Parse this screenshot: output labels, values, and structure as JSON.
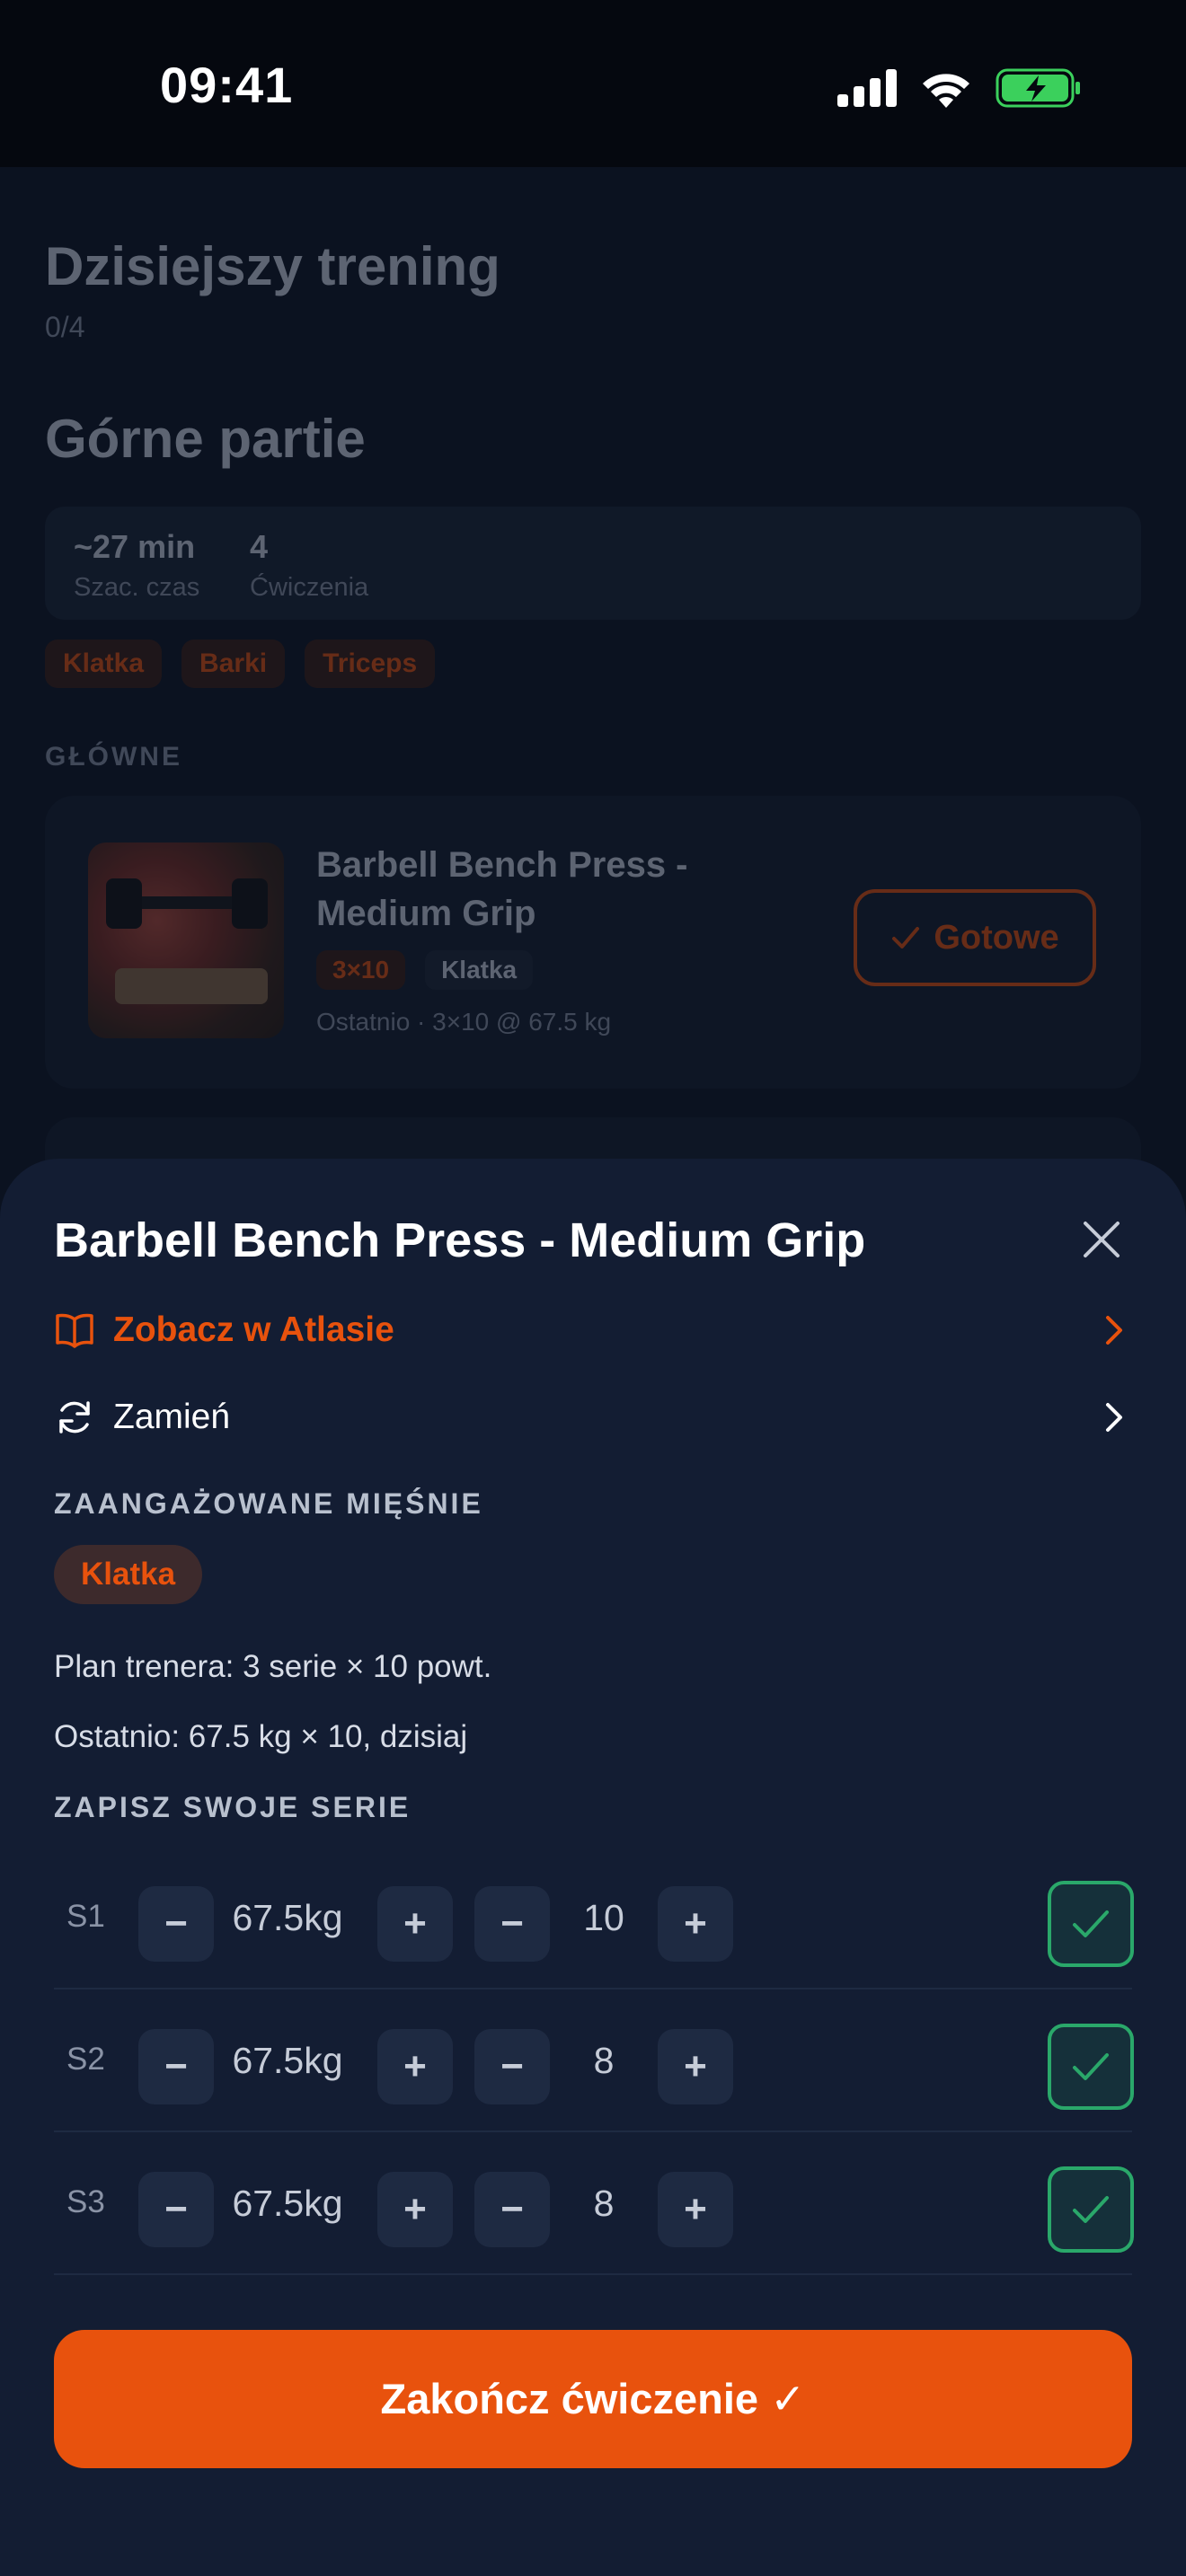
{
  "status_bar": {
    "time": "09:41"
  },
  "background": {
    "title": "Dzisiejszy trening",
    "progress": "0/4",
    "plan_name": "Górne partie",
    "stats": [
      {
        "value": "~27 min",
        "label": "Szac. czas"
      },
      {
        "value": "4",
        "label": "Ćwiczenia"
      }
    ],
    "tags": [
      "Klatka",
      "Barki",
      "Triceps"
    ],
    "section": "GŁÓWNE",
    "card": {
      "title": "Barbell Bench Press - Medium Grip",
      "scheme": "3×10",
      "muscle": "Klatka",
      "last": "Ostatnio · 3×10 @ 67.5 kg",
      "done_label": "Gotowe"
    }
  },
  "sheet": {
    "title": "Barbell Bench Press - Medium Grip",
    "atlas_label": "Zobacz w Atlasie",
    "swap_label": "Zamień",
    "muscles_header": "ZAANGAŻOWANE MIĘŚNIE",
    "muscle_chip": "Klatka",
    "plan_text": "Plan trenera: 3 serie × 10 powt.",
    "last_text": "Ostatnio: 67.5 kg × 10, dzisiaj",
    "sets_header": "ZAPISZ SWOJE SERIE",
    "sets": [
      {
        "label": "S1",
        "weight": "67.5kg",
        "reps": "10",
        "done": true
      },
      {
        "label": "S2",
        "weight": "67.5kg",
        "reps": "8",
        "done": true
      },
      {
        "label": "S3",
        "weight": "67.5kg",
        "reps": "8",
        "done": true
      }
    ],
    "minus_symbol": "−",
    "plus_symbol": "+",
    "finish_label": "Zakończ ćwiczenie ✓"
  },
  "colors": {
    "accent": "#e8520d",
    "sheet_bg": "#131d33",
    "check_green": "#2aa86a"
  }
}
